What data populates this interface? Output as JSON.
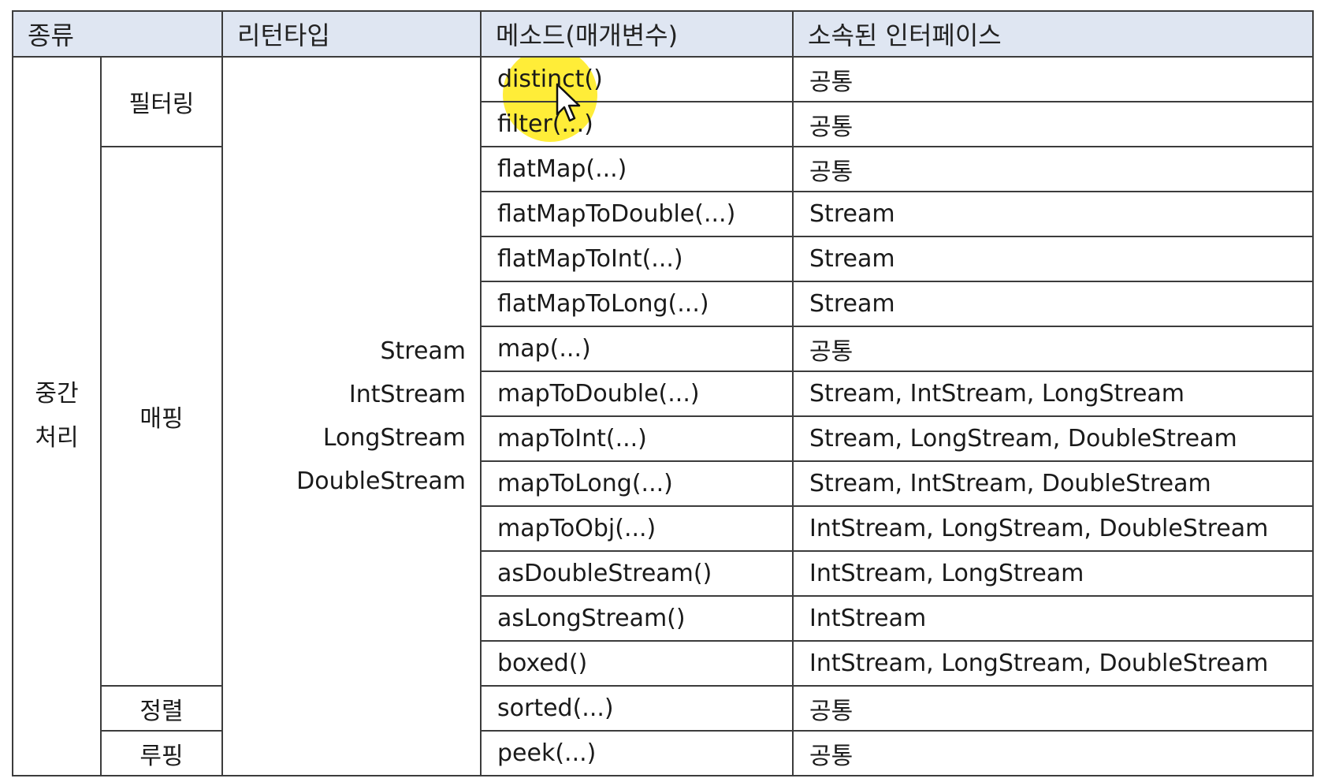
{
  "table": {
    "headers": {
      "category": "종류",
      "return_type": "리턴타입",
      "method": "메소드(매개변수)",
      "interface": "소속된 인터페이스"
    },
    "main_category": {
      "line1": "중간",
      "line2": "처리"
    },
    "sub_categories": {
      "filtering": "필터링",
      "mapping": "매핑",
      "sorting": "정렬",
      "looping": "루핑"
    },
    "return_types": [
      "Stream",
      "IntStream",
      "LongStream",
      "DoubleStream"
    ],
    "rows": [
      {
        "method": "distinct()",
        "interface": "공통"
      },
      {
        "method": "filter(...)",
        "interface": "공통"
      },
      {
        "method": "flatMap(...)",
        "interface": "공통"
      },
      {
        "method": "flatMapToDouble(...)",
        "interface": "Stream"
      },
      {
        "method": "flatMapToInt(...)",
        "interface": "Stream"
      },
      {
        "method": "flatMapToLong(...)",
        "interface": "Stream"
      },
      {
        "method": "map(...)",
        "interface": "공통"
      },
      {
        "method": "mapToDouble(...)",
        "interface": "Stream, IntStream, LongStream"
      },
      {
        "method": "mapToInt(...)",
        "interface": "Stream, LongStream, DoubleStream"
      },
      {
        "method": "mapToLong(...)",
        "interface": "Stream, IntStream, DoubleStream"
      },
      {
        "method": "mapToObj(...)",
        "interface": "IntStream, LongStream, DoubleStream"
      },
      {
        "method": "asDoubleStream()",
        "interface": "IntStream, LongStream"
      },
      {
        "method": "asLongStream()",
        "interface": "IntStream"
      },
      {
        "method": "boxed()",
        "interface": "IntStream, LongStream, DoubleStream"
      },
      {
        "method": "sorted(...)",
        "interface": "공통"
      },
      {
        "method": "peek(...)",
        "interface": "공통"
      }
    ]
  },
  "colors": {
    "header_bg": "#dfe6f2",
    "border": "#3c3c3c",
    "cursor_highlight": "#ffe800"
  },
  "icons": {
    "cursor": "mouse-pointer-icon"
  }
}
